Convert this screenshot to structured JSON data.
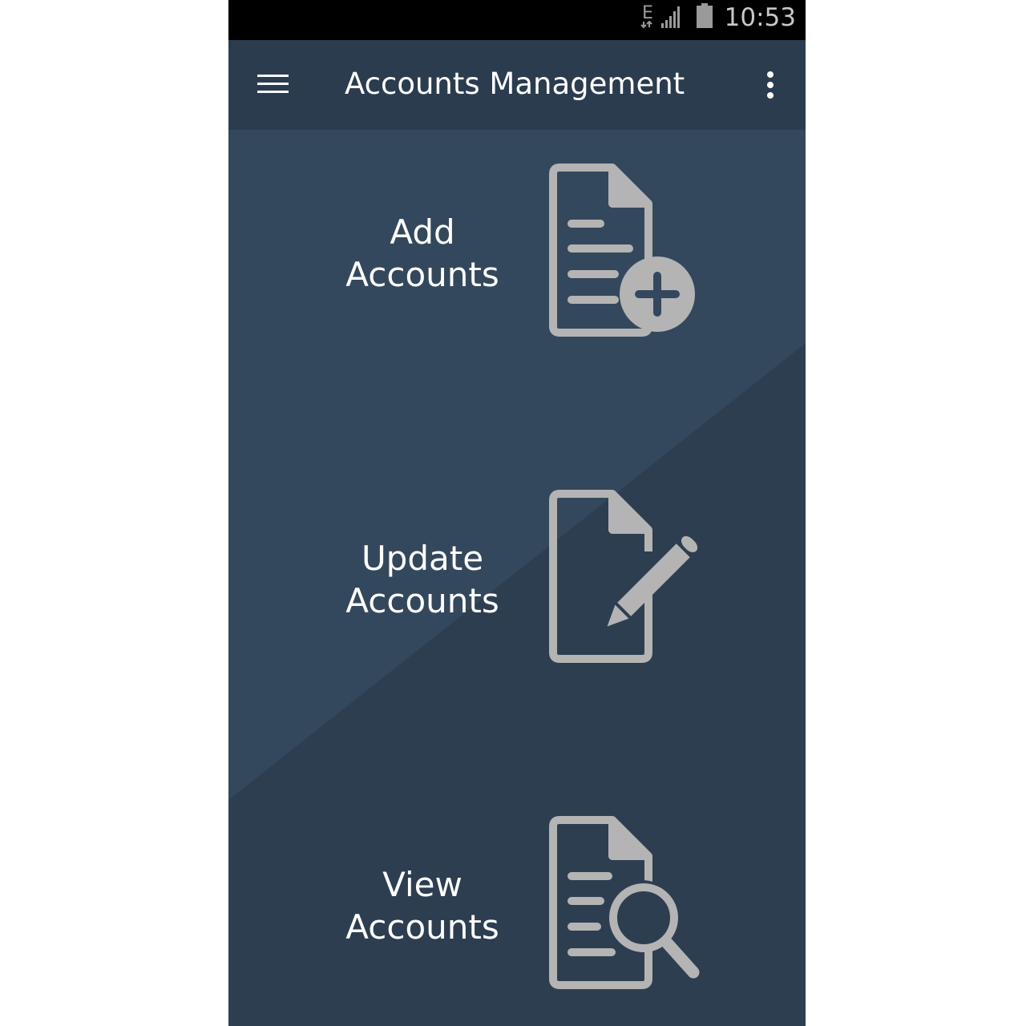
{
  "status_bar": {
    "time": "10:53",
    "network_type": "E",
    "icons": [
      "network-type-icon",
      "signal-icon",
      "battery-icon"
    ]
  },
  "app_bar": {
    "title": "Accounts Management",
    "menu_icon": "hamburger-menu-icon",
    "overflow_icon": "more-vertical-icon"
  },
  "menu": {
    "items": [
      {
        "line1": "Add",
        "line2": "Accounts",
        "icon": "document-add-icon"
      },
      {
        "line1": "Update",
        "line2": "Accounts",
        "icon": "document-edit-icon"
      },
      {
        "line1": "View",
        "line2": "Accounts",
        "icon": "document-search-icon"
      }
    ]
  },
  "colors": {
    "background": "#2e3e51",
    "app_bar": "#2c3c4f",
    "light_panel": "#34485d",
    "icon": "#b4b4b4",
    "text": "#ffffff"
  }
}
